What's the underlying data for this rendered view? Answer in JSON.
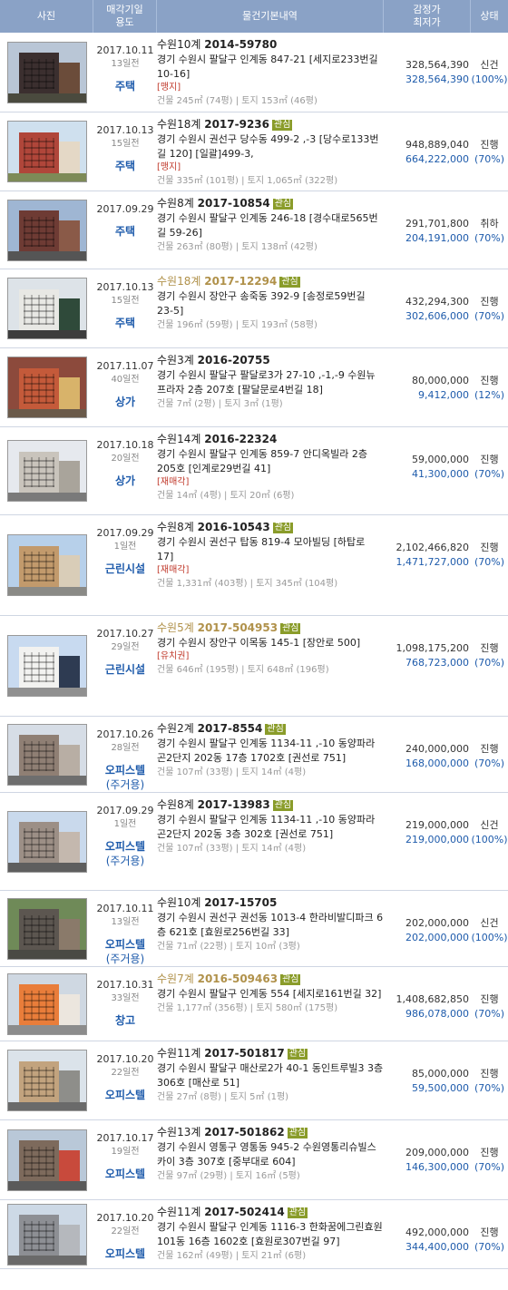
{
  "header": {
    "photo": "사진",
    "date_use": [
      "매각기일",
      "용도"
    ],
    "info": "물건기본내역",
    "price": [
      "감정가",
      "최저가"
    ],
    "status": "상태"
  },
  "listings": [
    {
      "date": "2017.10.11",
      "ago": "13일전",
      "use": "주택",
      "use_sub": "",
      "court": "수원10계",
      "case_no": "2014-59780",
      "interest": "",
      "faded": false,
      "addr": "경기 수원시 팔달구 인계동 847-21 [세지로233번길 10-16]",
      "flag": "[맹지]",
      "area": "건물 245㎡ (74평) | 토지 153㎡ (46평)",
      "appraisal": "328,564,390",
      "minimum": "328,564,390",
      "status": "신건",
      "percent": "(100%)",
      "colors": {
        "sky": "#b9c6d6",
        "bld": "#3b2f2f",
        "bld2": "#6b4c3a",
        "gnd": "#4a4a3e"
      }
    },
    {
      "date": "2017.10.13",
      "ago": "15일전",
      "use": "주택",
      "use_sub": "",
      "court": "수원18계",
      "case_no": "2017-9236",
      "interest": "관심",
      "faded": false,
      "addr": "경기 수원시 권선구 당수동 499-2 ,-3 [당수로133번길 120] [일괄]499-3,",
      "flag": "[맹지]",
      "area": "건물 335㎡ (101평) | 토지 1,065㎡ (322평)",
      "appraisal": "948,889,040",
      "minimum": "664,222,000",
      "status": "진행",
      "percent": "(70%)",
      "colors": {
        "sky": "#cfe0ee",
        "bld": "#b0463a",
        "bld2": "#e4d8c6",
        "gnd": "#7d8a57"
      }
    },
    {
      "date": "2017.09.29",
      "ago": "",
      "use": "주택",
      "use_sub": "",
      "court": "수원8계",
      "case_no": "2017-10854",
      "interest": "관심",
      "faded": false,
      "addr": "경기 수원시 팔달구 인계동 246-18 [경수대로565번길 59-26]",
      "flag": "",
      "area": "건물 263㎡ (80평) | 토지 138㎡ (42평)",
      "appraisal": "291,701,800",
      "minimum": "204,191,000",
      "status": "취하",
      "percent": "(70%)",
      "colors": {
        "sky": "#9fb6d3",
        "bld": "#6e3b34",
        "bld2": "#8a5a48",
        "gnd": "#555555"
      }
    },
    {
      "date": "2017.10.13",
      "ago": "15일전",
      "use": "주택",
      "use_sub": "",
      "court": "수원18계",
      "case_no": "2017-12294",
      "interest": "관심",
      "faded": true,
      "addr": "경기 수원시 장안구 송죽동 392-9 [송정로59번길 23-5]",
      "flag": "",
      "area": "건물 196㎡ (59평) | 토지 193㎡ (58평)",
      "appraisal": "432,294,300",
      "minimum": "302,606,000",
      "status": "진행",
      "percent": "(70%)",
      "colors": {
        "sky": "#dde3e8",
        "bld": "#e8e8e4",
        "bld2": "#2f4a3a",
        "gnd": "#3d3d3d"
      }
    },
    {
      "date": "2017.11.07",
      "ago": "40일전",
      "use": "상가",
      "use_sub": "",
      "court": "수원3계",
      "case_no": "2016-20755",
      "interest": "",
      "faded": false,
      "addr": "경기 수원시 팔달구 팔달로3가 27-10 ,-1,-9 수원뉴프라자 2층 207호 [팔달문로4번길 18]",
      "flag": "",
      "area": "건물 7㎡ (2평) | 토지 3㎡ (1평)",
      "appraisal": "80,000,000",
      "minimum": "9,412,000",
      "status": "진행",
      "percent": "(12%)",
      "colors": {
        "sky": "#8c4a3c",
        "bld": "#c45a3a",
        "bld2": "#d8b36a",
        "gnd": "#6a5a4a"
      }
    },
    {
      "date": "2017.10.18",
      "ago": "20일전",
      "use": "상가",
      "use_sub": "",
      "court": "수원14계",
      "case_no": "2016-22324",
      "interest": "",
      "faded": false,
      "addr": "경기 수원시 팔달구 인계동 859-7 안디옥빌라 2층 205호 [인계로29번길 41]",
      "flag": "[재매각]",
      "area": "건물 14㎡ (4평) | 토지 20㎡ (6평)",
      "appraisal": "59,000,000",
      "minimum": "41,300,000",
      "status": "진행",
      "percent": "(70%)",
      "colors": {
        "sky": "#e6e9ee",
        "bld": "#c9c4bc",
        "bld2": "#a9a49b",
        "gnd": "#7a7a7a"
      }
    },
    {
      "date": "2017.09.29",
      "ago": "1일전",
      "use": "근린시설",
      "use_sub": "",
      "court": "수원8계",
      "case_no": "2016-10543",
      "interest": "관심",
      "faded": false,
      "addr": "경기 수원시 권선구 탑동 819-4 모아빌딩 [하탑로 17]",
      "flag": "[재매각]",
      "area": "건물 1,331㎡ (403평) | 토지 345㎡ (104평)",
      "appraisal": "2,102,466,820",
      "minimum": "1,471,727,000",
      "status": "진행",
      "percent": "(70%)",
      "colors": {
        "sky": "#b7d0ea",
        "bld": "#c29a6c",
        "bld2": "#d9cdb8",
        "gnd": "#8a8a86"
      }
    },
    {
      "date": "2017.10.27",
      "ago": "29일전",
      "use": "근린시설",
      "use_sub": "",
      "court": "수원5계",
      "case_no": "2017-504953",
      "interest": "관심",
      "faded": true,
      "addr": "경기 수원시 장안구 이목동 145-1 [장안로 500]",
      "flag": "[유치권]",
      "area": "건물 646㎡ (195평) | 토지 648㎡ (196평)",
      "appraisal": "1,098,175,200",
      "minimum": "768,723,000",
      "status": "진행",
      "percent": "(70%)",
      "colors": {
        "sky": "#c8daf0",
        "bld": "#f2f2f0",
        "bld2": "#2e3b52",
        "gnd": "#909090"
      }
    },
    {
      "date": "2017.10.26",
      "ago": "28일전",
      "use": "오피스텔",
      "use_sub": "(주거용)",
      "court": "수원2계",
      "case_no": "2017-8554",
      "interest": "관심",
      "faded": false,
      "addr": "경기 수원시 팔달구 인계동 1134-11 ,-10 동양파라곤2단지 202동 17층 1702호 [권선로 751]",
      "flag": "",
      "area": "건물 107㎡ (33평) | 토지 14㎡ (4평)",
      "appraisal": "240,000,000",
      "minimum": "168,000,000",
      "status": "진행",
      "percent": "(70%)",
      "colors": {
        "sky": "#d6dde6",
        "bld": "#8f7f74",
        "bld2": "#b8aea4",
        "gnd": "#6e6e6e"
      }
    },
    {
      "date": "2017.09.29",
      "ago": "1일전",
      "use": "오피스텔",
      "use_sub": "(주거용)",
      "court": "수원8계",
      "case_no": "2017-13983",
      "interest": "관심",
      "faded": false,
      "addr": "경기 수원시 팔달구 인계동 1134-11 ,-10 동양파라곤2단지 202동 3층 302호 [권선로 751]",
      "flag": "",
      "area": "건물 107㎡ (33평) | 토지 14㎡ (4평)",
      "appraisal": "219,000,000",
      "minimum": "219,000,000",
      "status": "신건",
      "percent": "(100%)",
      "colors": {
        "sky": "#c9d9ec",
        "bld": "#9c8f86",
        "bld2": "#c4b8ae",
        "gnd": "#5e5e5e"
      }
    },
    {
      "date": "2017.10.11",
      "ago": "13일전",
      "use": "오피스텔",
      "use_sub": "(주거용)",
      "court": "수원10계",
      "case_no": "2017-15705",
      "interest": "",
      "faded": false,
      "addr": "경기 수원시 권선구 권선동 1013-4 한라비발디파크 6층 621호 [효원로256번길 33]",
      "flag": "",
      "area": "건물 71㎡ (22평) | 토지 10㎡ (3평)",
      "appraisal": "202,000,000",
      "minimum": "202,000,000",
      "status": "신건",
      "percent": "(100%)",
      "colors": {
        "sky": "#6f8a58",
        "bld": "#5c5650",
        "bld2": "#8a7a6a",
        "gnd": "#4a4a44"
      }
    },
    {
      "date": "2017.10.31",
      "ago": "33일전",
      "use": "창고",
      "use_sub": "",
      "court": "수원7계",
      "case_no": "2016-509463",
      "interest": "관심",
      "faded": true,
      "addr": "경기 수원시 팔달구 인계동 554 [세지로161번길 32]",
      "flag": "",
      "area": "건물 1,177㎡ (356평) | 토지 580㎡ (175평)",
      "appraisal": "1,408,682,850",
      "minimum": "986,078,000",
      "status": "진행",
      "percent": "(70%)",
      "colors": {
        "sky": "#cfd8e2",
        "bld": "#e97d3a",
        "bld2": "#ece6de",
        "gnd": "#8c8c8c"
      }
    },
    {
      "date": "2017.10.20",
      "ago": "22일전",
      "use": "오피스텔",
      "use_sub": "",
      "court": "수원11계",
      "case_no": "2017-501817",
      "interest": "관심",
      "faded": false,
      "addr": "경기 수원시 팔달구 매산로2가 40-1 동인트루빌3 3층 306호 [매산로 51]",
      "flag": "",
      "area": "건물 27㎡ (8평) | 토지 5㎡ (1평)",
      "appraisal": "85,000,000",
      "minimum": "59,500,000",
      "status": "진행",
      "percent": "(70%)",
      "colors": {
        "sky": "#dbe3ea",
        "bld": "#c2a37e",
        "bld2": "#8e8e8a",
        "gnd": "#6a6a6a"
      }
    },
    {
      "date": "2017.10.17",
      "ago": "19일전",
      "use": "오피스텔",
      "use_sub": "",
      "court": "수원13계",
      "case_no": "2017-501862",
      "interest": "관심",
      "faded": false,
      "addr": "경기 수원시 영통구 영통동 945-2 수원영통리슈빌스카이 3층 307호 [중부대로 604]",
      "flag": "",
      "area": "건물 97㎡ (29평) | 토지 16㎡ (5평)",
      "appraisal": "209,000,000",
      "minimum": "146,300,000",
      "status": "진행",
      "percent": "(70%)",
      "colors": {
        "sky": "#b9c8d8",
        "bld": "#7d6a5c",
        "bld2": "#c84a3c",
        "gnd": "#5a5a5a"
      }
    },
    {
      "date": "2017.10.20",
      "ago": "22일전",
      "use": "오피스텔",
      "use_sub": "",
      "court": "수원11계",
      "case_no": "2017-502414",
      "interest": "관심",
      "faded": false,
      "addr": "경기 수원시 팔달구 인계동 1116-3 한화꿈에그린효원 101동 16층 1602호 [효원로307번길 97]",
      "flag": "",
      "area": "건물 162㎡ (49평) | 토지 21㎡ (6평)",
      "appraisal": "492,000,000",
      "minimum": "344,400,000",
      "status": "진행",
      "percent": "(70%)",
      "colors": {
        "sky": "#cdd9e6",
        "bld": "#8d8f94",
        "bld2": "#b5b8bd",
        "gnd": "#6a6a6a"
      }
    }
  ]
}
